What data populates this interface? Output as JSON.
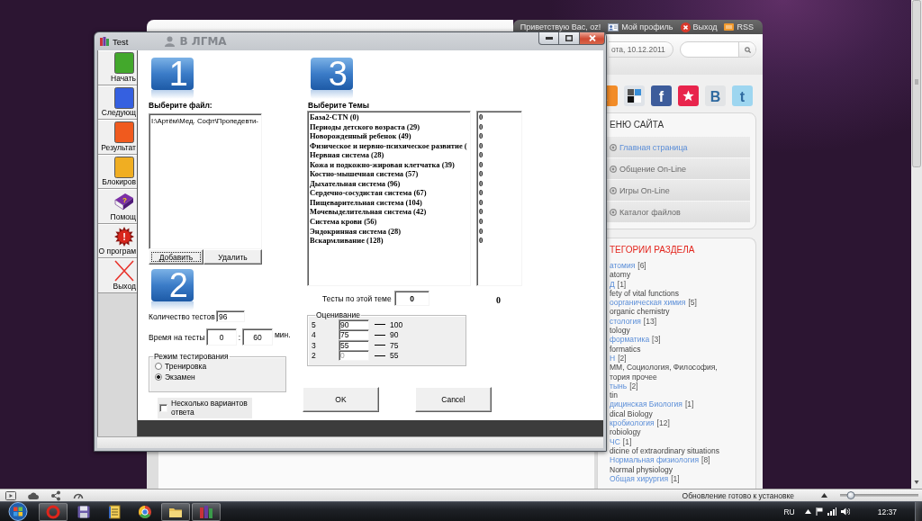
{
  "website": {
    "title_fragment": "В ЛГМА",
    "user_bar": [
      {
        "kind": "greeting",
        "label": "Приветствую Вас, oz!"
      },
      {
        "kind": "profile",
        "label": "Мой профиль"
      },
      {
        "kind": "logout",
        "label": "Выход"
      },
      {
        "kind": "rss",
        "label": "RSS"
      }
    ],
    "date": "ота, 10.12.2011",
    "share_links": [
      {
        "kind": "feed",
        "color": "#f28c28"
      },
      {
        "kind": "squares",
        "color": "#dfe3e8"
      },
      {
        "kind": "letter",
        "glyph": "f",
        "color": "#3d5c9b"
      },
      {
        "kind": "star",
        "color": "#e8244c"
      },
      {
        "kind": "letter",
        "glyph": "B",
        "color": "#e2e4e6"
      },
      {
        "kind": "letter",
        "glyph": "t",
        "color": "#9ed6f0"
      }
    ],
    "site_menu": {
      "title": "ЕНЮ САЙТА",
      "items": [
        {
          "label": "Главная страница",
          "selected": true
        },
        {
          "label": "Общение On-Line",
          "selected": false
        },
        {
          "label": "Игры On-Line",
          "selected": false
        },
        {
          "label": "Каталог файлов",
          "selected": false
        }
      ]
    },
    "categories": {
      "title": "ТЕГОРИИ РАЗДЕЛА",
      "items": [
        {
          "name": "атомия",
          "count": "[6]",
          "note_lines": [
            "atomy"
          ]
        },
        {
          "name": "Д",
          "count": "[1]",
          "note_lines": [
            "fety of vital functions"
          ]
        },
        {
          "name": "оорганическая химия",
          "count": "[5]",
          "note_lines": [
            "organic chemistry"
          ]
        },
        {
          "name": "стология",
          "count": "[13]",
          "note_lines": [
            "tology"
          ]
        },
        {
          "name": "форматика",
          "count": "[3]",
          "note_lines": [
            "formatics"
          ]
        },
        {
          "name": "Н",
          "count": "[2]",
          "note_lines": [
            "ММ, Социология, Философия,",
            "тория прочее"
          ]
        },
        {
          "name": "тынь",
          "count": "[2]",
          "note_lines": [
            "tin"
          ]
        },
        {
          "name": "дицинская Биология",
          "count": "[1]",
          "note_lines": [
            "dical Biology"
          ]
        },
        {
          "name": "кробиология",
          "count": "[12]",
          "note_lines": [
            "robiology"
          ]
        },
        {
          "name": "ЧС",
          "count": "[1]",
          "note_lines": [
            "dicine of extraordinary situations"
          ]
        },
        {
          "name": "Нормальная физиология",
          "count": "[8]",
          "note_lines": [
            "Normal physiology"
          ]
        },
        {
          "name": "Общая хирургия",
          "count": "[1]"
        }
      ]
    }
  },
  "test_window": {
    "title": "Test",
    "toolbar": [
      {
        "label": "Начать",
        "kind": "tile",
        "color": "#43a82c"
      },
      {
        "label": "Следующ",
        "kind": "tile",
        "color": "#3560e0"
      },
      {
        "label": "Результат",
        "kind": "tile",
        "color": "#f05a1e"
      },
      {
        "label": "Блокиров",
        "kind": "tile",
        "color": "#f0ae22"
      },
      {
        "label": "Помощ",
        "kind": "book",
        "glyph": "?"
      },
      {
        "label": "О програм",
        "kind": "burst",
        "glyph": "!"
      },
      {
        "label": "Выход",
        "kind": "cross"
      }
    ],
    "file_section": {
      "step": "1",
      "title": "Выберите файл:",
      "files": [
        {
          "path": "I:\\Артём\\Мед. Софт\\Пропедевти-",
          "selected": false
        }
      ],
      "buttons": [
        {
          "label": "Добавить",
          "focused": true
        },
        {
          "label": "Удалить",
          "focused": false
        }
      ]
    },
    "settings": {
      "step": "2",
      "test_count": {
        "label": "Количество тестов",
        "value": "96"
      },
      "time": {
        "label": "Время на тесты",
        "hours": "0",
        "separator": ":",
        "minutes": "60",
        "unit": "мин."
      },
      "mode": {
        "title": "Режим тестирования",
        "options": [
          {
            "label": "Тренировка",
            "selected": false
          },
          {
            "label": "Экзамен",
            "selected": true
          }
        ]
      },
      "multi_answer": {
        "label": "Несколько вариантов ответа",
        "checked": false
      }
    },
    "topics": {
      "step": "3",
      "title": "Выберите Темы",
      "items": [
        {
          "name": "База2-CTN (0)",
          "count": "0",
          "selected": false
        },
        {
          "name": "Периоды детского возраста (29)",
          "count": "0",
          "selected": false
        },
        {
          "name": "Новорожденный ребенок (49)",
          "count": "0",
          "selected": false
        },
        {
          "name": "Физическое и нервно-психическое развитие (",
          "count": "0",
          "selected": false
        },
        {
          "name": "Нервная система (28)",
          "count": "0",
          "selected": false
        },
        {
          "name": "Кожа и подкожно-жировая клетчатка (39)",
          "count": "0",
          "selected": false
        },
        {
          "name": "Костно-мышечная система (57)",
          "count": "0",
          "selected": false
        },
        {
          "name": "Дыхательная система (96)",
          "count": "0",
          "selected": false
        },
        {
          "name": "Сердечно-сосудистая система (67)",
          "count": "0",
          "selected": false
        },
        {
          "name": "Пищеварительная система (104)",
          "count": "0",
          "selected": false
        },
        {
          "name": "Мочевыделительная система (42)",
          "count": "0",
          "selected": false
        },
        {
          "name": "Система крови (56)",
          "count": "0",
          "selected": false
        },
        {
          "name": "Эндокринная система (28)",
          "count": "0",
          "selected": false
        },
        {
          "name": "Вскармливание (128)",
          "count": "0",
          "selected": false
        }
      ],
      "per_topic": {
        "label": "Тесты по этой теме",
        "value": "0"
      },
      "total": "0"
    },
    "grading": {
      "title": "Оценивание",
      "rows": [
        {
          "grade": "5",
          "from": "90",
          "to": "100",
          "disabled": false
        },
        {
          "grade": "4",
          "from": "75",
          "to": "90",
          "disabled": false
        },
        {
          "grade": "3",
          "from": "55",
          "to": "75",
          "disabled": false
        },
        {
          "grade": "2",
          "from": "0",
          "to": "55",
          "disabled": true
        }
      ]
    },
    "buttons": [
      {
        "label": "OK"
      },
      {
        "label": "Cancel"
      }
    ]
  },
  "status_bar": {
    "message": "Обновление готово к установке",
    "zoom": {
      "level": 0.14
    }
  },
  "taskbar": {
    "apps": [
      {
        "kind": "ring",
        "running": true
      },
      {
        "kind": "disk",
        "running": false
      },
      {
        "kind": "notepad",
        "running": false
      },
      {
        "kind": "sphere",
        "running": false
      },
      {
        "kind": "folder",
        "running": true
      },
      {
        "kind": "books",
        "running": true
      }
    ],
    "language": "RU",
    "clock": "12:37"
  }
}
